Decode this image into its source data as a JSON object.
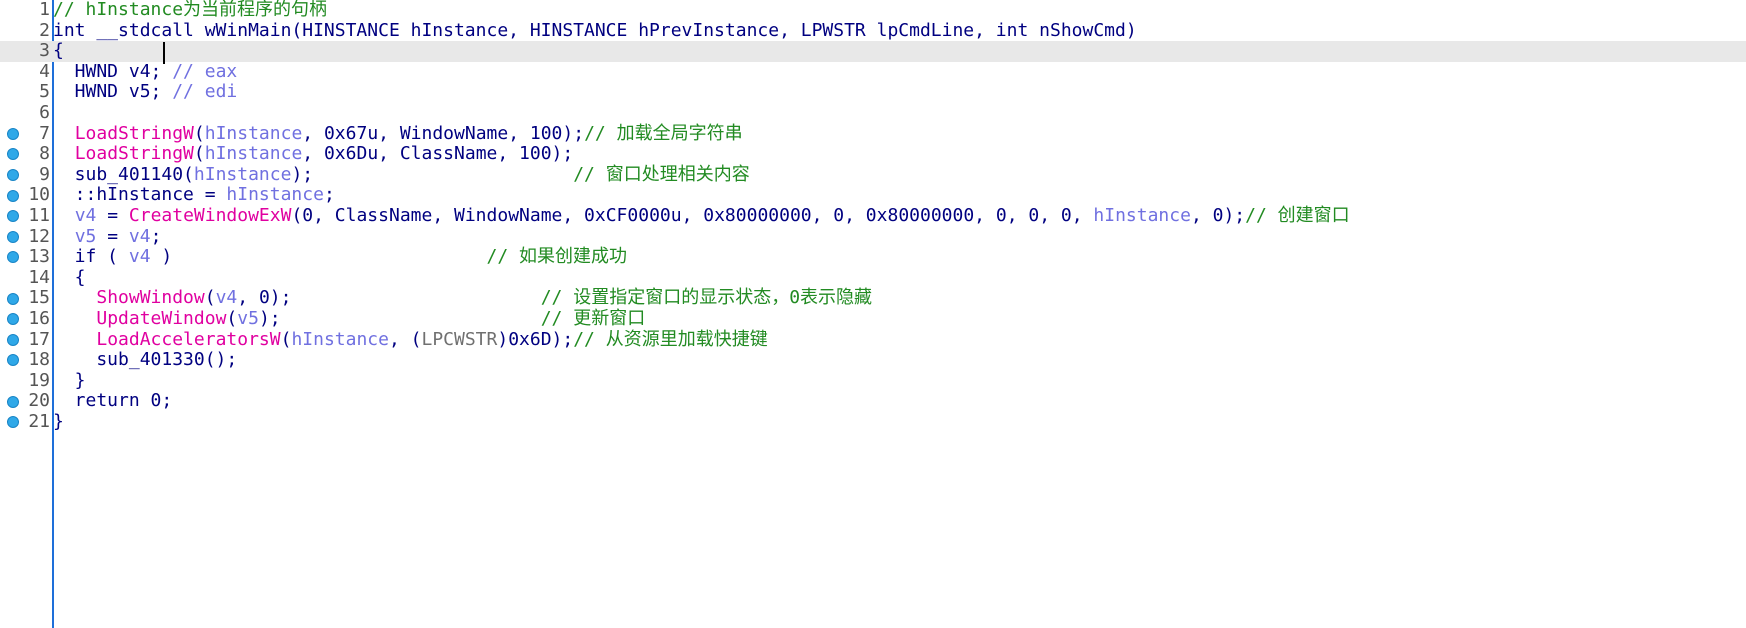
{
  "colors": {
    "keyword": "#000080",
    "function": "#e000a0",
    "variable": "#7070e0",
    "comment": "#228b22",
    "gray": "#707070",
    "gutter": "#1e6fd9",
    "breakpoint": "#2fa8e8",
    "current_line": "#e8e8e8"
  },
  "lines": [
    {
      "n": "1",
      "bp": false,
      "current": false,
      "tokens": [
        {
          "t": "// hInstance为当前程序的句柄",
          "c": "cmt"
        }
      ]
    },
    {
      "n": "2",
      "bp": false,
      "current": false,
      "tokens": [
        {
          "t": "int __stdcall wWinMain(HINSTANCE hInstance, HINSTANCE hPrevInstance, LPWSTR lpCmdLine, int nShowCmd)",
          "c": "txt"
        }
      ]
    },
    {
      "n": "3",
      "bp": false,
      "current": true,
      "tokens": [
        {
          "t": "{",
          "c": "txt"
        }
      ]
    },
    {
      "n": "4",
      "bp": false,
      "current": false,
      "tokens": [
        {
          "t": "  HWND v4; ",
          "c": "txt"
        },
        {
          "t": "// eax",
          "c": "var"
        }
      ]
    },
    {
      "n": "5",
      "bp": false,
      "current": false,
      "tokens": [
        {
          "t": "  HWND v5; ",
          "c": "txt"
        },
        {
          "t": "// edi",
          "c": "var"
        }
      ]
    },
    {
      "n": "6",
      "bp": false,
      "current": false,
      "tokens": []
    },
    {
      "n": "7",
      "bp": true,
      "current": false,
      "tokens": [
        {
          "t": "  ",
          "c": "txt"
        },
        {
          "t": "LoadStringW",
          "c": "fn"
        },
        {
          "t": "(",
          "c": "txt"
        },
        {
          "t": "hInstance",
          "c": "var"
        },
        {
          "t": ", 0x67u, WindowName, 100);",
          "c": "txt"
        },
        {
          "t": "// 加载全局字符串",
          "c": "cmt"
        }
      ]
    },
    {
      "n": "8",
      "bp": true,
      "current": false,
      "tokens": [
        {
          "t": "  ",
          "c": "txt"
        },
        {
          "t": "LoadStringW",
          "c": "fn"
        },
        {
          "t": "(",
          "c": "txt"
        },
        {
          "t": "hInstance",
          "c": "var"
        },
        {
          "t": ", 0x6Du, ClassName, 100);",
          "c": "txt"
        }
      ]
    },
    {
      "n": "9",
      "bp": true,
      "current": false,
      "tokens": [
        {
          "t": "  sub_401140(",
          "c": "txt"
        },
        {
          "t": "hInstance",
          "c": "var"
        },
        {
          "t": ");                        ",
          "c": "txt"
        },
        {
          "t": "// 窗口处理相关内容",
          "c": "cmt"
        }
      ]
    },
    {
      "n": "10",
      "bp": true,
      "current": false,
      "tokens": [
        {
          "t": "  ::hInstance = ",
          "c": "txt"
        },
        {
          "t": "hInstance",
          "c": "var"
        },
        {
          "t": ";",
          "c": "txt"
        }
      ]
    },
    {
      "n": "11",
      "bp": true,
      "current": false,
      "tokens": [
        {
          "t": "  ",
          "c": "txt"
        },
        {
          "t": "v4",
          "c": "var"
        },
        {
          "t": " = ",
          "c": "txt"
        },
        {
          "t": "CreateWindowExW",
          "c": "fn"
        },
        {
          "t": "(0, ClassName, WindowName, 0xCF0000u, 0x80000000, 0, 0x80000000, 0, 0, 0, ",
          "c": "txt"
        },
        {
          "t": "hInstance",
          "c": "var"
        },
        {
          "t": ", 0);",
          "c": "txt"
        },
        {
          "t": "// 创建窗口",
          "c": "cmt"
        }
      ]
    },
    {
      "n": "12",
      "bp": true,
      "current": false,
      "tokens": [
        {
          "t": "  ",
          "c": "txt"
        },
        {
          "t": "v5",
          "c": "var"
        },
        {
          "t": " = ",
          "c": "txt"
        },
        {
          "t": "v4",
          "c": "var"
        },
        {
          "t": ";",
          "c": "txt"
        }
      ]
    },
    {
      "n": "13",
      "bp": true,
      "current": false,
      "tokens": [
        {
          "t": "  if ( ",
          "c": "txt"
        },
        {
          "t": "v4",
          "c": "var"
        },
        {
          "t": " )                             ",
          "c": "txt"
        },
        {
          "t": "// 如果创建成功",
          "c": "cmt"
        }
      ]
    },
    {
      "n": "14",
      "bp": false,
      "current": false,
      "tokens": [
        {
          "t": "  {",
          "c": "txt"
        }
      ]
    },
    {
      "n": "15",
      "bp": true,
      "current": false,
      "tokens": [
        {
          "t": "    ",
          "c": "txt"
        },
        {
          "t": "ShowWindow",
          "c": "fn"
        },
        {
          "t": "(",
          "c": "txt"
        },
        {
          "t": "v4",
          "c": "var"
        },
        {
          "t": ", 0);                       ",
          "c": "txt"
        },
        {
          "t": "// 设置指定窗口的显示状态，0表示隐藏",
          "c": "cmt"
        }
      ]
    },
    {
      "n": "16",
      "bp": true,
      "current": false,
      "tokens": [
        {
          "t": "    ",
          "c": "txt"
        },
        {
          "t": "UpdateWindow",
          "c": "fn"
        },
        {
          "t": "(",
          "c": "txt"
        },
        {
          "t": "v5",
          "c": "var"
        },
        {
          "t": ");                        ",
          "c": "txt"
        },
        {
          "t": "// 更新窗口",
          "c": "cmt"
        }
      ]
    },
    {
      "n": "17",
      "bp": true,
      "current": false,
      "tokens": [
        {
          "t": "    ",
          "c": "txt"
        },
        {
          "t": "LoadAcceleratorsW",
          "c": "fn"
        },
        {
          "t": "(",
          "c": "txt"
        },
        {
          "t": "hInstance",
          "c": "var"
        },
        {
          "t": ", (",
          "c": "txt"
        },
        {
          "t": "LPCWSTR",
          "c": "gray"
        },
        {
          "t": ")0x6D);",
          "c": "txt"
        },
        {
          "t": "// 从资源里加载快捷键",
          "c": "cmt"
        }
      ]
    },
    {
      "n": "18",
      "bp": true,
      "current": false,
      "tokens": [
        {
          "t": "    sub_401330();",
          "c": "txt"
        }
      ]
    },
    {
      "n": "19",
      "bp": false,
      "current": false,
      "tokens": [
        {
          "t": "  }",
          "c": "txt"
        }
      ]
    },
    {
      "n": "20",
      "bp": true,
      "current": false,
      "tokens": [
        {
          "t": "  return 0;",
          "c": "txt"
        }
      ]
    },
    {
      "n": "21",
      "bp": true,
      "current": false,
      "tokens": [
        {
          "t": "}",
          "c": "txt"
        }
      ]
    }
  ]
}
